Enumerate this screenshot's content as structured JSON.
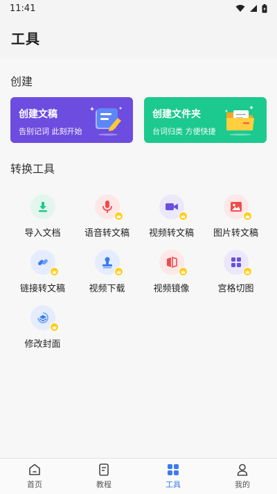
{
  "status_bar": {
    "time": "11:41"
  },
  "header": {
    "title": "工具"
  },
  "create_section": {
    "title": "创建",
    "cards": [
      {
        "title": "创建文稿",
        "subtitle": "告别记词 此刻开始",
        "color": "#6d4ddf"
      },
      {
        "title": "创建文件夹",
        "subtitle": "台词归类 方便快捷",
        "color": "#1cc98e"
      }
    ]
  },
  "tools_section": {
    "title": "转换工具",
    "tools": [
      {
        "label": "导入文档",
        "icon": "import-doc-icon",
        "vip": false
      },
      {
        "label": "语音转文稿",
        "icon": "microphone-icon",
        "vip": true
      },
      {
        "label": "视频转文稿",
        "icon": "video-camera-icon",
        "vip": true
      },
      {
        "label": "图片转文稿",
        "icon": "image-icon",
        "vip": true
      },
      {
        "label": "链接转文稿",
        "icon": "link-icon",
        "vip": true
      },
      {
        "label": "视频下载",
        "icon": "download-stamp-icon",
        "vip": true
      },
      {
        "label": "视频镜像",
        "icon": "mirror-icon",
        "vip": true
      },
      {
        "label": "宫格切图",
        "icon": "grid-icon",
        "vip": true
      },
      {
        "label": "修改封面",
        "icon": "cover-icon",
        "vip": true
      }
    ]
  },
  "bottom_nav": {
    "items": [
      {
        "label": "首页",
        "icon": "home-icon",
        "active": false
      },
      {
        "label": "教程",
        "icon": "tutorial-doc-icon",
        "active": false
      },
      {
        "label": "工具",
        "icon": "tools-grid-icon",
        "active": true
      },
      {
        "label": "我的",
        "icon": "profile-icon",
        "active": false
      }
    ]
  },
  "colors": {
    "accent": "#3a7bf0",
    "vip": "#ffcc1a"
  }
}
